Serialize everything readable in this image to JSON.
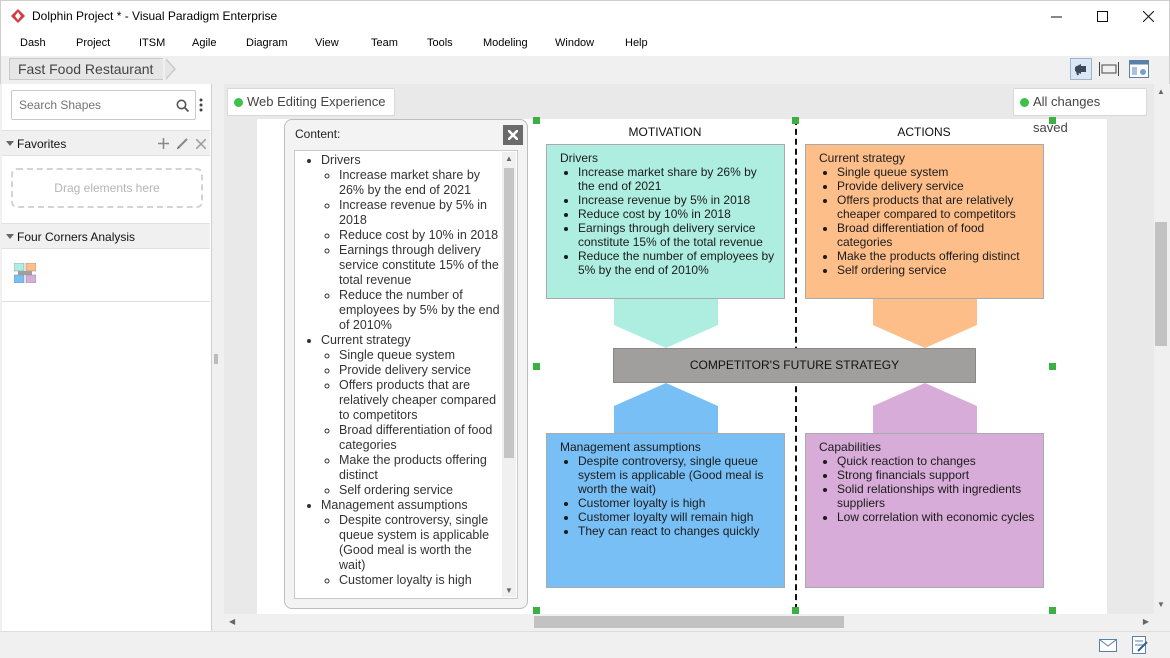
{
  "window": {
    "title": "Dolphin Project * - Visual Paradigm Enterprise",
    "controls": [
      "minimize",
      "maximize",
      "close"
    ]
  },
  "menu": [
    "Dash",
    "Project",
    "ITSM",
    "Agile",
    "Diagram",
    "View",
    "Team",
    "Tools",
    "Modeling",
    "Window",
    "Help"
  ],
  "breadcrumb": "Fast Food Restaurant",
  "left_panel": {
    "search_placeholder": "Search Shapes",
    "favorites_label": "Favorites",
    "dropzone_label": "Drag elements here",
    "four_corners_label": "Four Corners Analysis"
  },
  "canvas": {
    "web_editing_label": "Web Editing Experience",
    "save_status": "All changes saved"
  },
  "content_panel": {
    "title": "Content:",
    "groups": [
      {
        "name": "Drivers",
        "items": [
          "Increase market share by 26% by the end of 2021",
          "Increase revenue by 5% in 2018",
          "Reduce cost by 10% in 2018",
          "Earnings through delivery service constitute 15% of the total revenue",
          "Reduce the number of employees by 5% by the end of 2010%"
        ]
      },
      {
        "name": "Current strategy",
        "items": [
          "Single queue system",
          "Provide delivery service",
          "Offers products that are relatively cheaper compared to competitors",
          "Broad differentiation of food categories",
          "Make the products offering distinct",
          "Self ordering service"
        ]
      },
      {
        "name": "Management assumptions",
        "items": [
          "Despite controversy, single queue system is applicable (Good meal is worth the wait)",
          "Customer loyalty is high"
        ]
      }
    ]
  },
  "diagram": {
    "motivation_title": "MOTIVATION",
    "actions_title": "ACTIONS",
    "center_label": "COMPETITOR'S FUTURE STRATEGY",
    "drivers": {
      "title": "Drivers",
      "color": "#aeeee0",
      "items": [
        "Increase market share by 26% by the end of 2021",
        "Increase revenue by 5% in 2018",
        "Reduce cost by 10% in 2018",
        "Earnings through delivery service constitute 15% of the total revenue",
        "Reduce the number of employees by 5% by the end of 2010%"
      ]
    },
    "current_strategy": {
      "title": "Current strategy",
      "color": "#fdbe8a",
      "items": [
        "Single queue system",
        "Provide delivery service",
        "Offers products that are relatively cheaper compared to competitors",
        "Broad differentiation of food categories",
        "Make the products offering distinct",
        "Self ordering service"
      ]
    },
    "management_assumptions": {
      "title": "Management assumptions",
      "color": "#78bff5",
      "items": [
        "Despite controversy, single queue system is applicable (Good meal is worth the wait)",
        "Customer loyalty is high",
        "Customer loyalty will remain high",
        "They can react to changes quickly"
      ]
    },
    "capabilities": {
      "title": "Capabilities",
      "color": "#d8acd8",
      "items": [
        "Quick reaction to changes",
        "Strong financials support",
        "Solid relationships with ingredients suppliers",
        "Low correlation with economic cycles"
      ]
    }
  }
}
